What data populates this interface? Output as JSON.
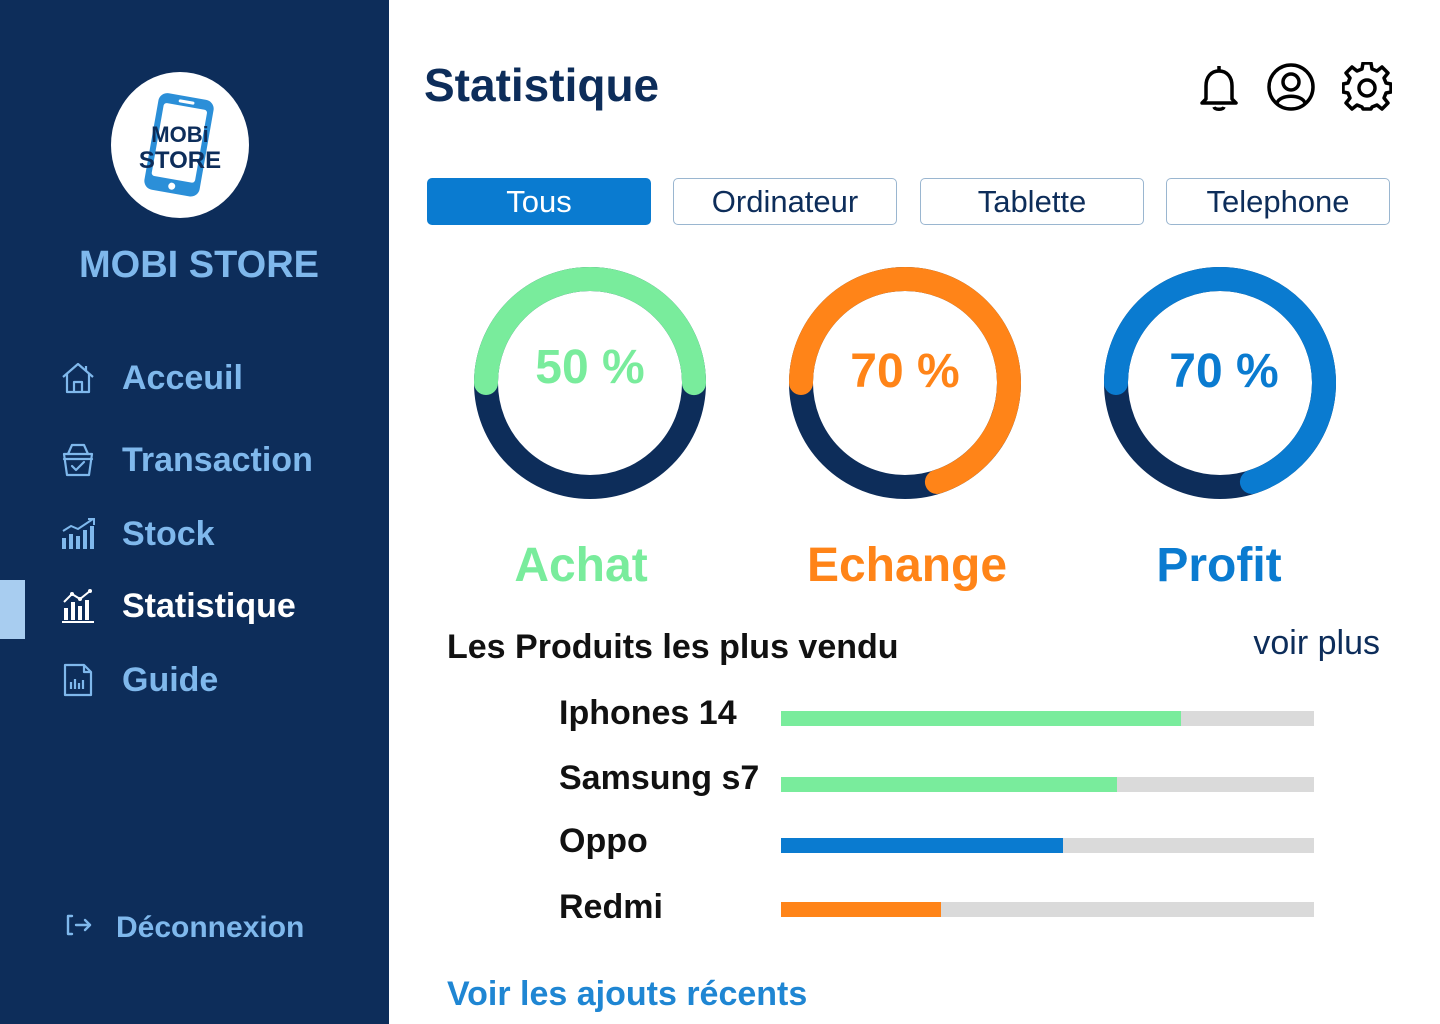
{
  "sidebar": {
    "logo_text_line1": "MOBi",
    "logo_text_line2": "STORE",
    "brand_name": "MOBI STORE",
    "items": [
      {
        "label": "Acceuil",
        "icon": "home-icon"
      },
      {
        "label": "Transaction",
        "icon": "basket-icon"
      },
      {
        "label": "Stock",
        "icon": "bar-chart-icon"
      },
      {
        "label": "Statistique",
        "icon": "stats-icon",
        "active": true
      },
      {
        "label": "Guide",
        "icon": "document-icon"
      }
    ],
    "logout_label": "Déconnexion"
  },
  "header": {
    "title": "Statistique",
    "icons": [
      "bell-icon",
      "user-icon",
      "gear-icon"
    ]
  },
  "tabs": [
    {
      "label": "Tous",
      "selected": true
    },
    {
      "label": "Ordinateur"
    },
    {
      "label": "Tablette"
    },
    {
      "label": "Telephone"
    }
  ],
  "stats": [
    {
      "value_text": "50 %",
      "label": "Achat",
      "percent": 50,
      "color": "#79ec9c",
      "track": "#0d2d5a"
    },
    {
      "value_text": "70 %",
      "label": "Echange",
      "percent": 70,
      "color": "#ff8418",
      "track": "#0d2d5a"
    },
    {
      "value_text": "70 %",
      "label": "Profit",
      "percent": 70,
      "color": "#0a7bd0",
      "track": "#0d2d5a"
    }
  ],
  "products": {
    "title": "Les Produits les plus vendu",
    "see_more": "voir plus",
    "items": [
      {
        "name": "Iphones 14",
        "share": 0.75,
        "color": "#79ec9c"
      },
      {
        "name": "Samsung s7",
        "share": 0.63,
        "color": "#79ec9c"
      },
      {
        "name": "Oppo",
        "share": 0.53,
        "color": "#0a7bd0"
      },
      {
        "name": "Redmi",
        "share": 0.3,
        "color": "#ff8418"
      }
    ]
  },
  "recent_link": "Voir les ajouts récents",
  "colors": {
    "sidebar_bg": "#0d2d5a",
    "sidebar_text": "#7fb8ec",
    "accent": "#0a7bd0",
    "green": "#79ec9c",
    "orange": "#ff8418"
  }
}
